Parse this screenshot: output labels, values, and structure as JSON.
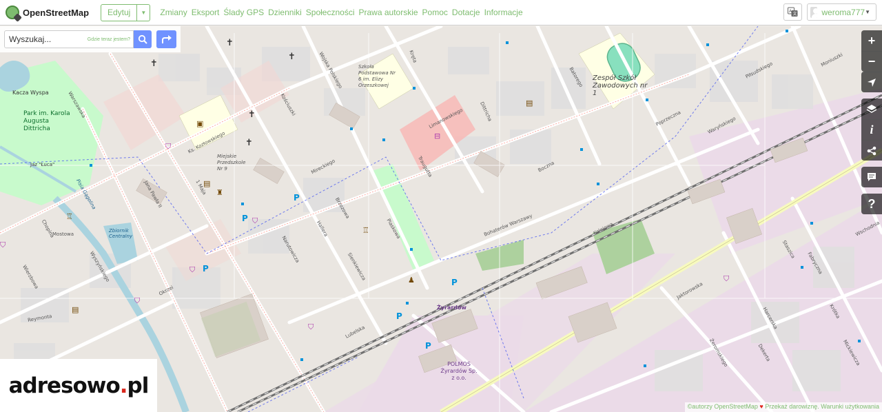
{
  "header": {
    "app_name": "OpenStreetMap",
    "edit_label": "Edytuj",
    "nav_links": [
      "Zmiany",
      "Eksport",
      "Ślady GPS",
      "Dzienniki",
      "Społeczności",
      "Prawa autorskie",
      "Pomoc",
      "Dotacje",
      "Informacje"
    ],
    "username": "weroma777"
  },
  "search": {
    "placeholder": "Wyszukaj...",
    "where_am_i": "Gdzie teraz jestem?"
  },
  "map_labels": {
    "school_6": "Szkoła Podstawowa Nr 6 im. Elizy Orzeszkowej",
    "school_zawod": "Zespół Szkół Zawodowych nr 1",
    "kindergarten": "Miejskie Przedszkole Nr 9",
    "park": "Park im. Karola Augusta Dittricha",
    "kacza": "Kacza Wyspa",
    "jaz": "Jaz \"Łuca\"",
    "reservoir": "Zbiornik Centralny",
    "station": "Żyrardów",
    "polmos": "POLMOS Żyrardów Sp. z o.o.",
    "river": "Pisia Gągolina",
    "streets": [
      "1 Maja",
      "Kościuszki",
      "Mireckiego",
      "Okrzei",
      "Wyszyńskiego",
      "Bohaterów Warszawy",
      "Jaktorowska",
      "Kolejowa",
      "Sienkiewicza",
      "Narutowicza",
      "Chopina",
      "Harcerska",
      "Piaskowa",
      "Batorego",
      "Reymonta",
      "Mostowa",
      "Wierzbowa",
      "Limanowskiego",
      "Kręta",
      "Brzozowa",
      "Waryńskiego",
      "Warszawska",
      "Dittricha",
      "Hallera",
      "Lubelska",
      "Wojska Polskiego",
      "Ks. Kozłowskiego",
      "Jana Pawła II",
      "Piłsudskiego",
      "Traugutta",
      "Moniuszki",
      "Wschodnia",
      "Fabryczna",
      "Dekerta",
      "Krótka",
      "Staszica",
      "Mickiewicza",
      "Żeromskiego",
      "Boczna",
      "Poprzeczna"
    ]
  },
  "controls": {
    "zoom_in": "+",
    "zoom_out": "−",
    "info": "i",
    "help": "?"
  },
  "attribution": {
    "copyright": "©autorzy OpenStreetMap",
    "donate": "Przekaż darowiznę.",
    "terms": "Warunki użytkowania"
  },
  "watermark": {
    "brand_main": "adresowo",
    "brand_dot": ".",
    "brand_tld": "pl"
  },
  "colors": {
    "osm_green": "#7ebc6f",
    "button_blue": "#7092ff",
    "residential": "#e0dfdf",
    "industrial": "#ebdbe8",
    "park": "#c8facc",
    "water": "#aad3df",
    "school": "#ffffe5",
    "railway": "#707070",
    "road_yellow": "#f7fabf"
  }
}
